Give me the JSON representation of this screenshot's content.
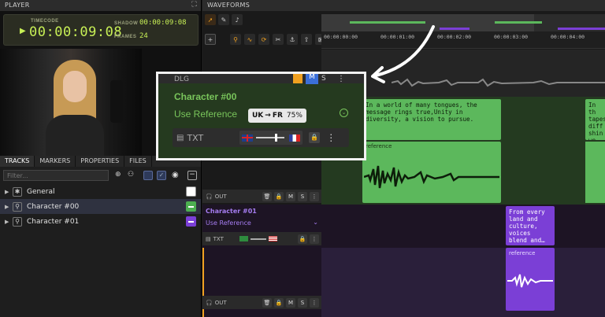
{
  "player": {
    "header": "PLAYER",
    "timecode_label": "TIMECODE",
    "timecode": "00:00:09:08",
    "shadow_label": "SHADOW",
    "shadow": "00:00:09:08",
    "frames_label": "FRAMES",
    "frames": "24"
  },
  "tracks_panel": {
    "tabs": [
      "TRACKS",
      "MARKERS",
      "PROPERTIES",
      "FILES"
    ],
    "filter_placeholder": "Filter...",
    "items": [
      {
        "label": "General",
        "icon": "asterisk-icon",
        "color": "#ffffff"
      },
      {
        "label": "Character #00",
        "icon": "person-icon",
        "color": "#4caf50"
      },
      {
        "label": "Character #01",
        "icon": "person-icon",
        "color": "#7b3fd6"
      }
    ]
  },
  "waveforms": {
    "header": "WAVEFORMS",
    "ruler": [
      "00:00:00:00",
      "00:00:01:00",
      "00:00:02:00",
      "00:00:03:00",
      "00:00:04:00"
    ],
    "lane_out_label": "OUT",
    "m_label": "M",
    "s_label": "S",
    "char01": {
      "name": "Character #01",
      "reference": "Use Reference",
      "txt_label": "TXT"
    },
    "clip_text_green_1": "In a world of many tongues, the\nmessage rings true,Unity in\ndiversity, a vision to pursue.",
    "clip_text_green_2": "In th\ntapes\ndiff\nshin\nwe f",
    "clip_text_purple": "From every\nland and\nculture,\nvoices\nblend and…",
    "reference_label": "reference"
  },
  "zoom": {
    "top_label": "DLG",
    "m_label": "M",
    "s_label": "S",
    "character": "Character #00",
    "reference": "Use Reference",
    "txt_label": "TXT",
    "tooltip_from": "UK",
    "tooltip_to": "FR",
    "tooltip_value": "75%",
    "colors": {
      "green_clip": "#5cb85c",
      "purple_clip": "#7b3fd6",
      "accent_orange": "#f0a020"
    }
  }
}
